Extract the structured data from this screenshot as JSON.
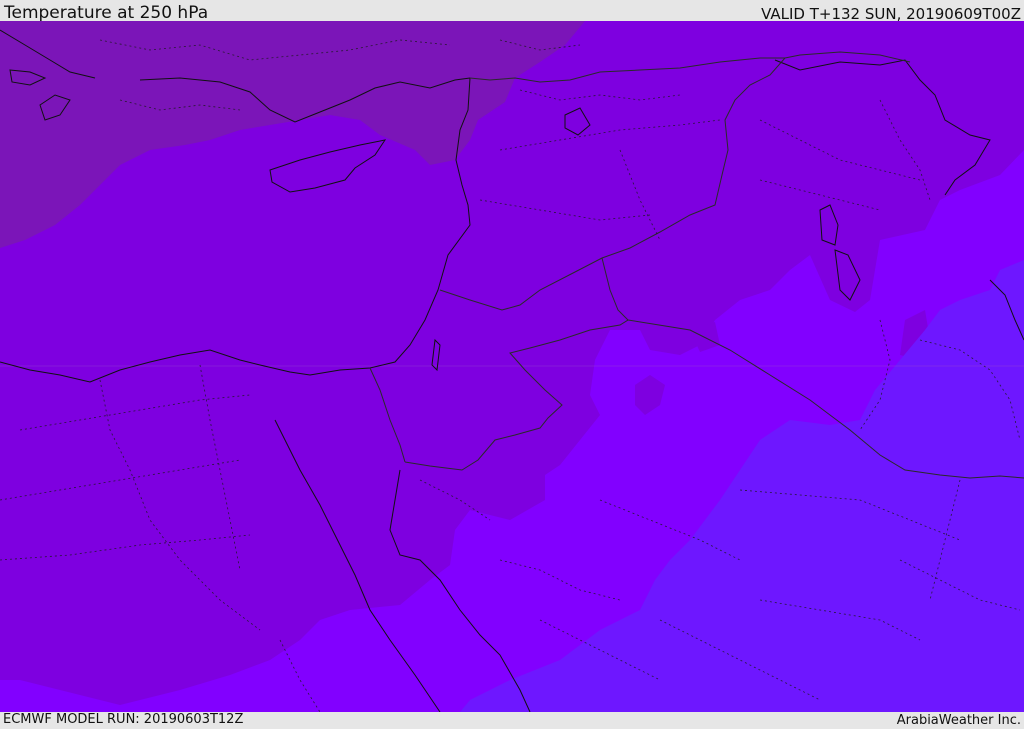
{
  "header": {
    "title": "Temperature at 250 hPa",
    "valid": "VALID T+132 SUN, 20190609T00Z"
  },
  "footer": {
    "model_run": "ECMWF MODEL RUN: 20190603T12Z",
    "credit": "ArabiaWeather Inc."
  },
  "colors": {
    "band_warm": "#7b15b8",
    "band_mid": "#7e00e0",
    "band_mid2": "#8200ff",
    "band_cool": "#6e17ff",
    "coastline": "#111111",
    "border": "#2a2a2a"
  }
}
